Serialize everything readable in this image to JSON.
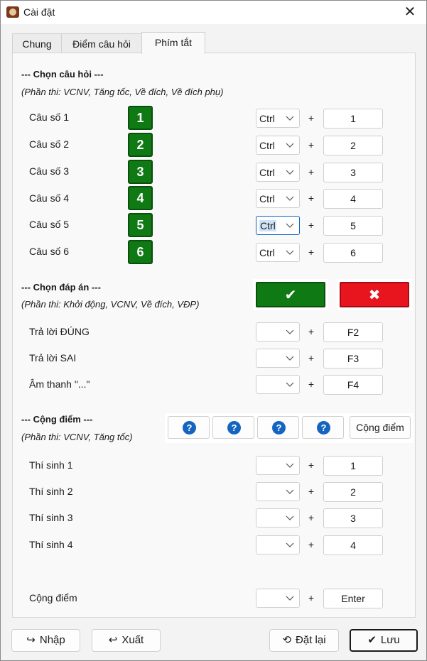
{
  "window": {
    "title": "Cài đặt",
    "close_glyph": "✕"
  },
  "tabs": [
    {
      "label": "Chung"
    },
    {
      "label": "Điểm câu hỏi"
    },
    {
      "label": "Phím tắt"
    }
  ],
  "chon_cau_hoi": {
    "title": "--- Chọn câu hỏi ---",
    "subtitle": "(Phần thi: VCNV, Tăng tốc, Về đích, Về đích phụ)",
    "rows": [
      {
        "label": "Câu số 1",
        "badge": "1",
        "modifier": "Ctrl",
        "key": "1"
      },
      {
        "label": "Câu số 2",
        "badge": "2",
        "modifier": "Ctrl",
        "key": "2"
      },
      {
        "label": "Câu số 3",
        "badge": "3",
        "modifier": "Ctrl",
        "key": "3"
      },
      {
        "label": "Câu số 4",
        "badge": "4",
        "modifier": "Ctrl",
        "key": "4"
      },
      {
        "label": "Câu số 5",
        "badge": "5",
        "modifier": "Ctrl",
        "key": "5"
      },
      {
        "label": "Câu số 6",
        "badge": "6",
        "modifier": "Ctrl",
        "key": "6"
      }
    ]
  },
  "chon_dap_an": {
    "title": "--- Chọn đáp án ---",
    "subtitle": "(Phần thi: Khởi động, VCNV, Về đích, VĐP)",
    "correct_glyph": "✔",
    "wrong_glyph": "✖",
    "correct_color": "#0f7a14",
    "wrong_color": "#e8141e",
    "rows": [
      {
        "label": "Trả lời ĐÚNG",
        "modifier": "",
        "key": "F2"
      },
      {
        "label": "Trả lời SAI",
        "modifier": "",
        "key": "F3"
      },
      {
        "label": "Âm thanh \"...\"",
        "modifier": "",
        "key": "F4"
      }
    ]
  },
  "cong_diem": {
    "title": "--- Cộng điểm ---",
    "subtitle": "(Phần thi: VCNV, Tăng tốc)",
    "q_glyph": "?",
    "cong_button": "Cộng điểm",
    "rows": [
      {
        "label": "Thí sinh 1",
        "modifier": "",
        "key": "1"
      },
      {
        "label": "Thí sinh 2",
        "modifier": "",
        "key": "2"
      },
      {
        "label": "Thí sinh 3",
        "modifier": "",
        "key": "3"
      },
      {
        "label": "Thí sinh 4",
        "modifier": "",
        "key": "4"
      }
    ],
    "total_row": {
      "label": "Cộng điểm",
      "modifier": "",
      "key": "Enter"
    }
  },
  "plus_sign": "+",
  "footer": {
    "import_label": "Nhập",
    "import_icon": "↪",
    "export_label": "Xuất",
    "export_icon": "↩",
    "reset_label": "Đặt lại",
    "reset_icon": "⟲",
    "save_label": "Lưu",
    "save_icon": "✔"
  }
}
